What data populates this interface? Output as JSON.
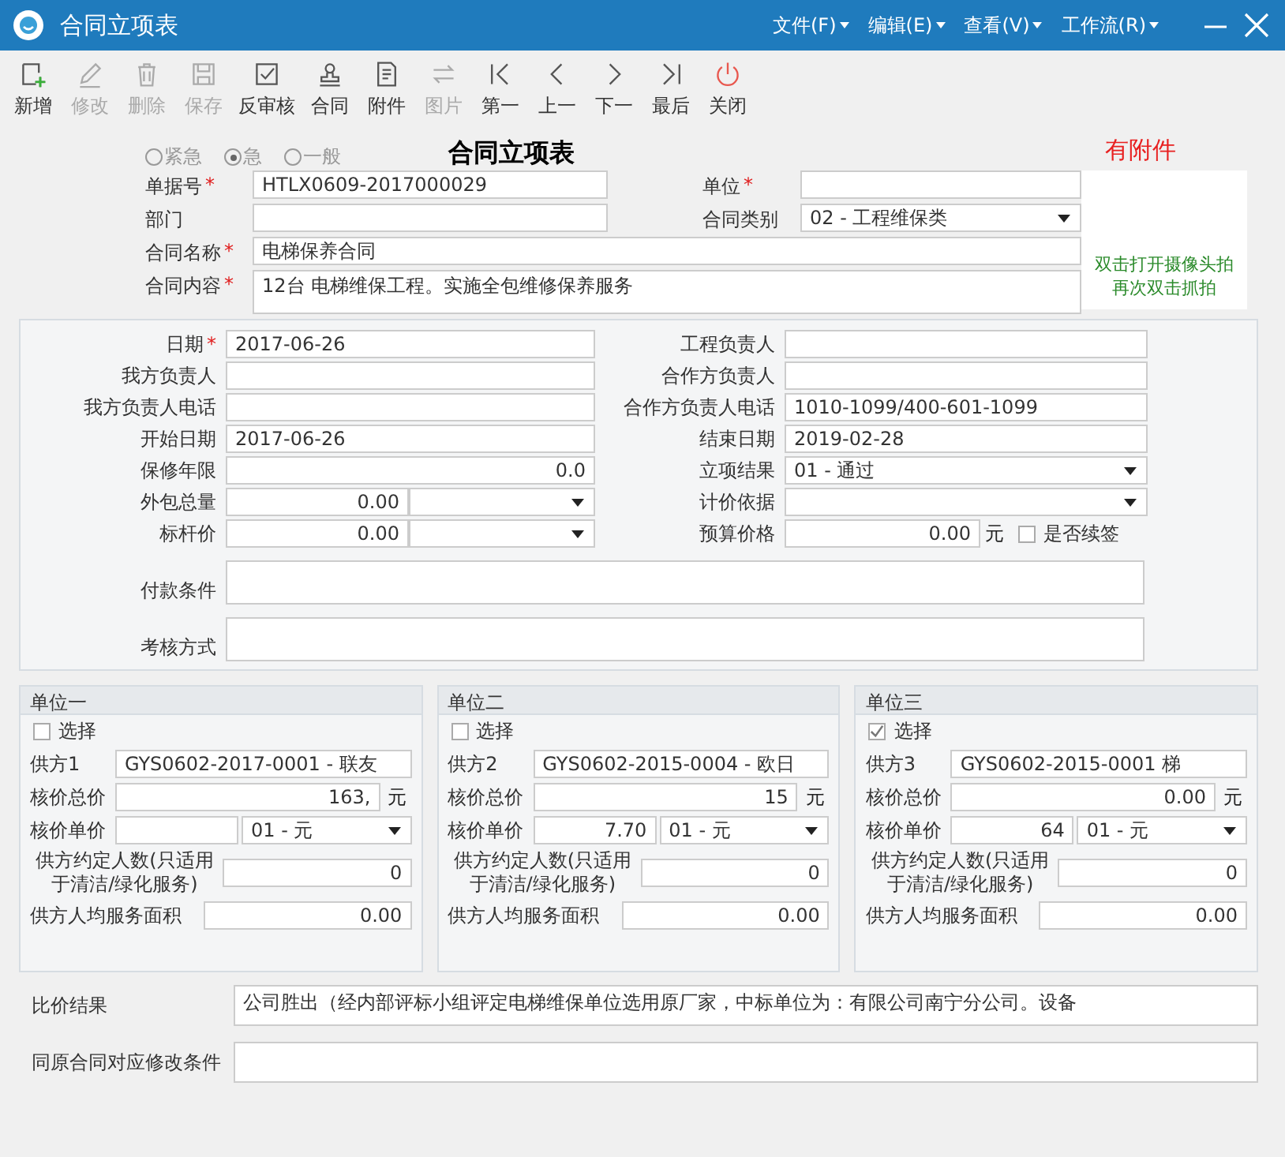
{
  "window": {
    "title": "合同立项表"
  },
  "menus": [
    "文件(F)",
    "编辑(E)",
    "查看(V)",
    "工作流(R)"
  ],
  "toolbar": [
    {
      "label": "新增",
      "disabled": false
    },
    {
      "label": "修改",
      "disabled": true
    },
    {
      "label": "删除",
      "disabled": true
    },
    {
      "label": "保存",
      "disabled": true
    },
    {
      "label": "反审核",
      "disabled": false
    },
    {
      "label": "合同",
      "disabled": false
    },
    {
      "label": "附件",
      "disabled": false
    },
    {
      "label": "图片",
      "disabled": true
    },
    {
      "label": "第一",
      "disabled": false
    },
    {
      "label": "上一",
      "disabled": false
    },
    {
      "label": "下一",
      "disabled": false
    },
    {
      "label": "最后",
      "disabled": false
    },
    {
      "label": "关闭",
      "disabled": false
    }
  ],
  "priority": [
    {
      "label": "紧急",
      "selected": false
    },
    {
      "label": "急",
      "selected": true
    },
    {
      "label": "一般",
      "selected": false
    }
  ],
  "form_title": "合同立项表",
  "attachment_note": "有附件",
  "header_rows": [
    [
      {
        "label": "单据号",
        "required_mark": "*",
        "value": "HTLX0609-2017000029"
      },
      {
        "label": "单位",
        "required_mark": "*"
      }
    ],
    [
      {
        "label": "部门"
      },
      {
        "label": "合同类别",
        "value": "02 - 工程维保类",
        "kind": "dropdown"
      }
    ],
    [
      {
        "label": "合同名称",
        "required_mark": "*",
        "value": "电梯保养合同"
      }
    ],
    [
      {
        "label": "合同内容",
        "required_mark": "*",
        "value": "12台  电梯维保工程。实施全包维修保养服务"
      }
    ]
  ],
  "camera_hint": [
    "双击打开摄像头拍",
    "再次双击抓拍"
  ],
  "details": [
    [
      {
        "label": "日期",
        "required_mark": "*",
        "value": "2017-06-26"
      },
      {
        "label": "工程负责人"
      }
    ],
    [
      {
        "label": "我方负责人"
      },
      {
        "label": "合作方负责人"
      }
    ],
    [
      {
        "label": "我方负责人电话"
      },
      {
        "label": "合作方负责人电话",
        "value": "1010-1099/400-601-1099"
      }
    ],
    [
      {
        "label": "开始日期",
        "value": "2017-06-26"
      },
      {
        "label": "结束日期",
        "value": "2019-02-28"
      }
    ],
    [
      {
        "label": "保修年限",
        "value": "0.0",
        "kind": "number"
      },
      {
        "label": "立项结果",
        "value": "01 - 通过",
        "kind": "dropdown"
      }
    ],
    [
      {
        "label": "外包总量",
        "value": "0.00",
        "kind": "number_dropdown"
      },
      {
        "label": "计价依据",
        "kind": "dropdown"
      }
    ],
    [
      {
        "label": "标杆价",
        "value": "0.00",
        "kind": "number_dropdown"
      },
      {
        "label": "预算价格",
        "value": "0.00",
        "kind": "price",
        "unit": "元",
        "check_label": "是否续签",
        "checked": false
      }
    ]
  ],
  "memos": [
    {
      "label": "付款条件"
    },
    {
      "label": "考核方式"
    }
  ],
  "suppliers": [
    {
      "title": "单位一",
      "select_label": "选择",
      "checked": false,
      "supplier_label": "供方1",
      "supplier": "GYS0602-2017-0001 -    联友",
      "total_label": "核价总价",
      "total": "163,",
      "unit": "元",
      "price_label": "核价单价",
      "price_unit": "01 - 元",
      "people_label": "供方约定人数(只适用于清洁/绿化服务)",
      "people": "0",
      "area_label": "供方人均服务面积",
      "area": "0.00"
    },
    {
      "title": "单位二",
      "select_label": "选择",
      "checked": false,
      "supplier_label": "供方2",
      "supplier": "GYS0602-2015-0004 -    欧日",
      "total_label": "核价总价",
      "total": "15",
      "unit": "元",
      "price_label": "核价单价",
      "price": "7.70",
      "price_unit": "01 - 元",
      "people_label": "供方约定人数(只适用于清洁/绿化服务)",
      "people": "0",
      "area_label": "供方人均服务面积",
      "area": "0.00"
    },
    {
      "title": "单位三",
      "select_label": "选择",
      "checked": true,
      "supplier_label": "供方3",
      "supplier": "GYS0602-2015-0001     梯",
      "total_label": "核价总价",
      "total": "0.00",
      "unit": "元",
      "price_label": "核价单价",
      "price": "64",
      "price_unit": "01 - 元",
      "people_label": "供方约定人数(只适用于清洁/绿化服务)",
      "people": "0",
      "area_label": "供方人均服务面积",
      "area": "0.00"
    }
  ],
  "bottom": [
    {
      "label": "比价结果",
      "value": "公司胜出（经内部评标小组评定电梯维保单位选用原厂家，中标单位为：有限公司南宁分公司。设备"
    },
    {
      "label": "同原合同对应修改条件"
    }
  ]
}
